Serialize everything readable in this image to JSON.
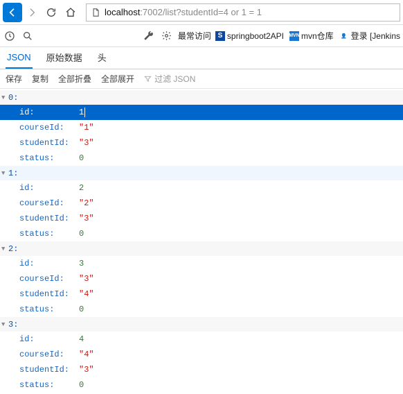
{
  "url": {
    "prefix": "localhost",
    "rest": ":7002/list?studentId=4 or 1 = 1"
  },
  "bookmarks": {
    "freq": "最常访问",
    "items": [
      {
        "label": "springboot2API",
        "favbg": "#0d47a1",
        "favtxt": "S",
        "favcolor": "#fff"
      },
      {
        "label": "mvn仓库",
        "favbg": "#1976d2",
        "favtxt": "MVN",
        "favcolor": "#fff"
      },
      {
        "label": "登录 [Jenkins",
        "favbg": "transparent",
        "favtxt": "👤",
        "favcolor": "#333"
      }
    ]
  },
  "tabs": {
    "json": "JSON",
    "raw": "原始数据",
    "head": "头"
  },
  "subbar": {
    "save": "保存",
    "copy": "复制",
    "collapse": "全部折叠",
    "expand": "全部展开",
    "filter": "过滤 JSON"
  },
  "records": [
    {
      "idx": "0:",
      "hl": false,
      "firstSelected": true,
      "props": [
        {
          "k": "id:",
          "v": "1",
          "t": "num"
        },
        {
          "k": "courseId:",
          "v": "\"1\"",
          "t": "str"
        },
        {
          "k": "studentId:",
          "v": "\"3\"",
          "t": "str"
        },
        {
          "k": "status:",
          "v": "0",
          "t": "num"
        }
      ]
    },
    {
      "idx": "1:",
      "hl": true,
      "firstSelected": false,
      "props": [
        {
          "k": "id:",
          "v": "2",
          "t": "num"
        },
        {
          "k": "courseId:",
          "v": "\"2\"",
          "t": "str"
        },
        {
          "k": "studentId:",
          "v": "\"3\"",
          "t": "str"
        },
        {
          "k": "status:",
          "v": "0",
          "t": "num"
        }
      ]
    },
    {
      "idx": "2:",
      "hl": false,
      "firstSelected": false,
      "props": [
        {
          "k": "id:",
          "v": "3",
          "t": "num"
        },
        {
          "k": "courseId:",
          "v": "\"3\"",
          "t": "str"
        },
        {
          "k": "studentId:",
          "v": "\"4\"",
          "t": "str"
        },
        {
          "k": "status:",
          "v": "0",
          "t": "num"
        }
      ]
    },
    {
      "idx": "3:",
      "hl": false,
      "firstSelected": false,
      "props": [
        {
          "k": "id:",
          "v": "4",
          "t": "num"
        },
        {
          "k": "courseId:",
          "v": "\"4\"",
          "t": "str"
        },
        {
          "k": "studentId:",
          "v": "\"3\"",
          "t": "str"
        },
        {
          "k": "status:",
          "v": "0",
          "t": "num"
        }
      ]
    }
  ]
}
